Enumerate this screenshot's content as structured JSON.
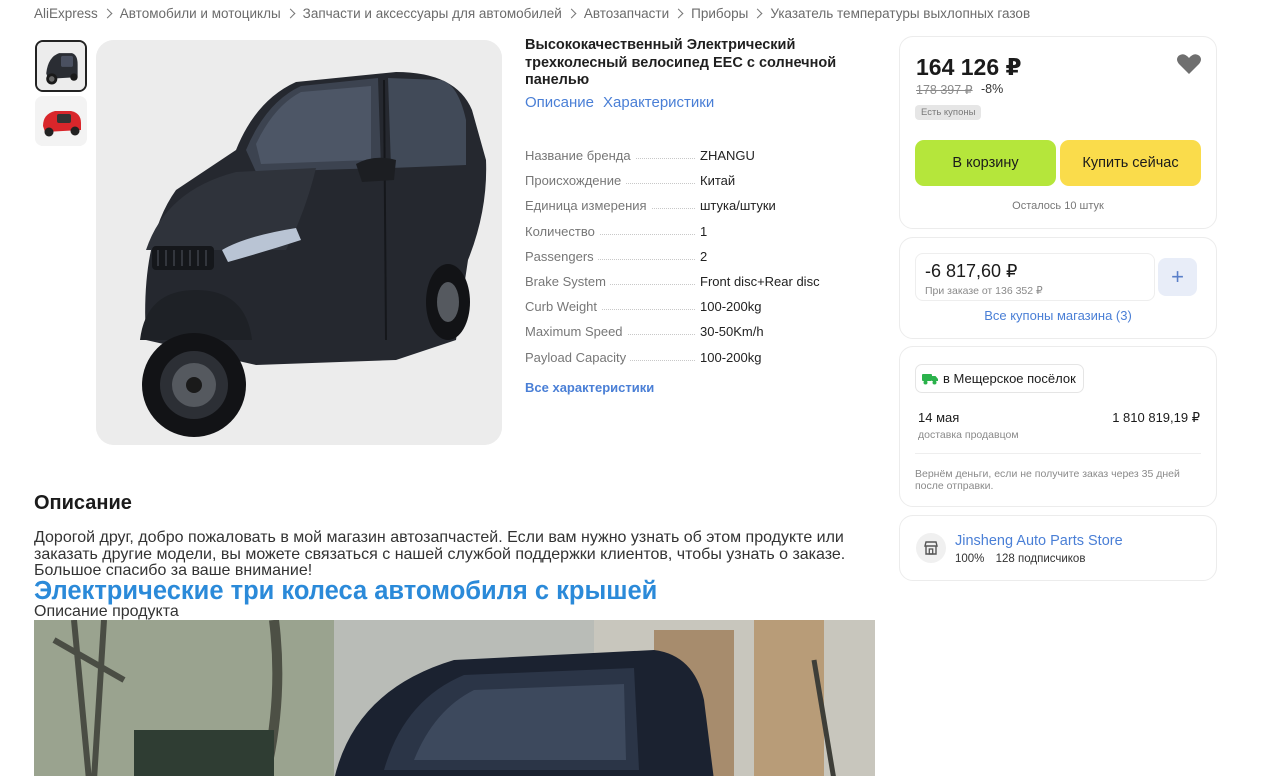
{
  "breadcrumb": [
    "AliExpress",
    "Автомобили и мотоциклы",
    "Запчасти и аксессуары для автомобилей",
    "Автозапчасти",
    "Приборы",
    "Указатель температуры выхлопных газов"
  ],
  "product": {
    "title": "Высококачественный Электрический трехколесный велосипед EEC с солнечной панелью",
    "tabs": [
      "Описание",
      "Характеристики"
    ],
    "specs": [
      {
        "key": "Название бренда",
        "value": "ZHANGU"
      },
      {
        "key": "Происхождение",
        "value": "Китай"
      },
      {
        "key": "Единица измерения",
        "value": "штука/штуки"
      },
      {
        "key": "Количество",
        "value": "1"
      },
      {
        "key": "Passengers",
        "value": "2"
      },
      {
        "key": "Brake System",
        "value": "Front disc+Rear disc"
      },
      {
        "key": "Curb Weight",
        "value": "100-200kg"
      },
      {
        "key": "Maximum Speed",
        "value": "30-50Km/h"
      },
      {
        "key": "Payload Capacity",
        "value": "100-200kg"
      }
    ],
    "all_specs_link": "Все характеристики"
  },
  "price": {
    "current": "164 126 ₽",
    "old": "178 397 ₽",
    "discount": "-8%",
    "coupons_badge": "Есть купоны",
    "add_to_cart": "В корзину",
    "buy_now": "Купить сейчас",
    "stock": "Осталось 10 штук"
  },
  "coupon": {
    "amount": "-6 817,60 ₽",
    "condition": "При заказе от 136 352 ₽",
    "add": "+",
    "all_coupons": "Все купоны магазина (3)"
  },
  "delivery": {
    "location": "в Мещерское посёлок",
    "date": "14 мая",
    "price": "1 810 819,19 ₽",
    "by": "доставка продавцом",
    "refund": "Вернём деньги, если не получите заказ через 35 дней после отправки."
  },
  "store": {
    "name": "Jinsheng Auto Parts Store",
    "rating": "100%",
    "followers": "128 подписчиков"
  },
  "description": {
    "heading": "Описание",
    "text": "Дорогой друг, добро пожаловать в мой магазин автозапчастей. Если вам нужно узнать об этом продукте или заказать другие модели, вы можете связаться с нашей службой поддержки клиентов, чтобы узнать о заказе. Большое спасибо за ваше внимание!",
    "title": "Электрические три колеса автомобиля с крышей",
    "subtitle": "Описание продукта"
  },
  "colors": {
    "accent": "#4a7fd6",
    "cart_button": "#b5e63b",
    "buy_button": "#fadc4b",
    "desc_title": "#2b8ad9"
  },
  "icons": {
    "breadcrumb_separator": "chevron-right-icon",
    "wishlist": "heart-icon",
    "delivery": "truck-icon",
    "store": "store-icon",
    "coupon_add": "plus-icon"
  }
}
